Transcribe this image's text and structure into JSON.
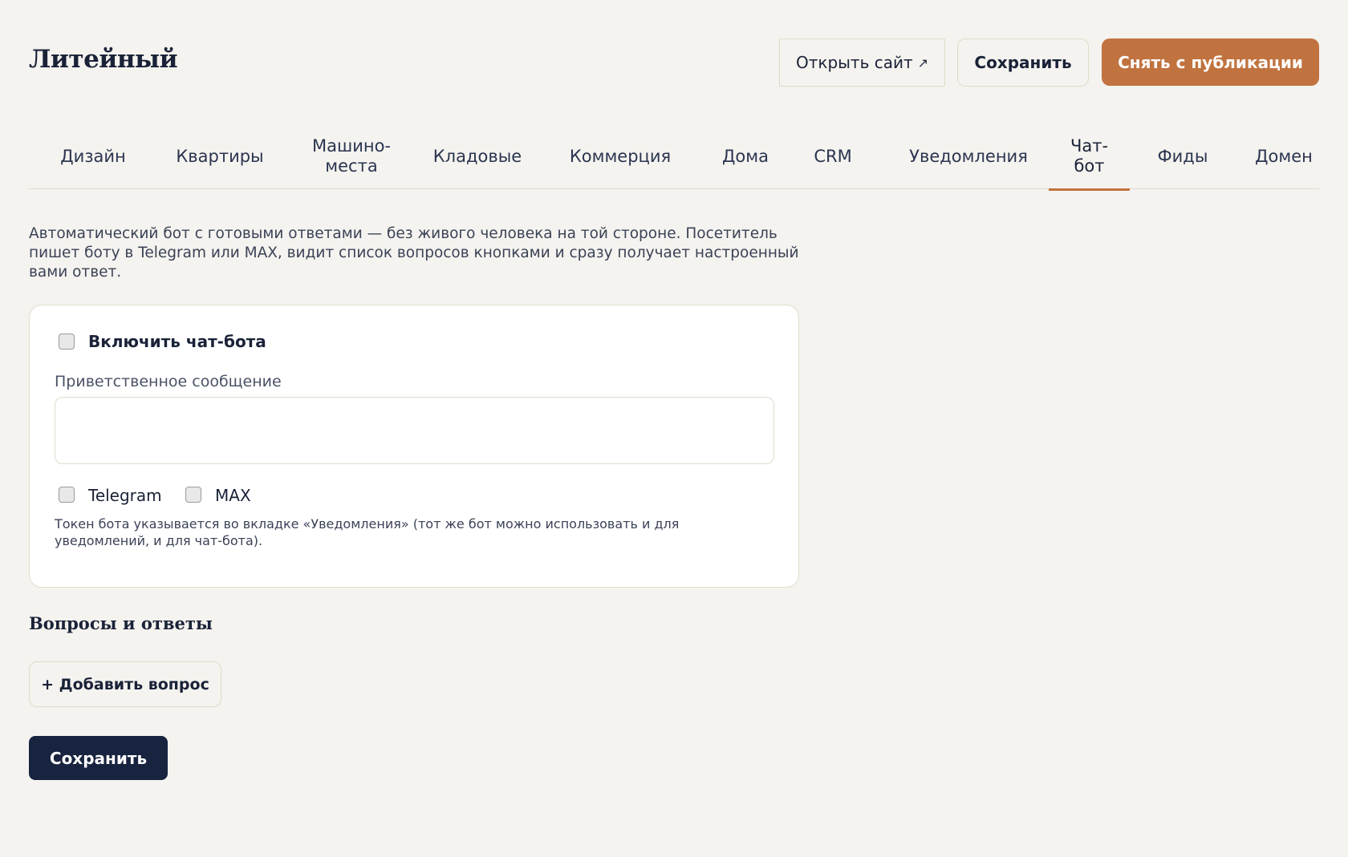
{
  "header": {
    "title": "Литейный",
    "open_site_label": "Открыть сайт",
    "open_site_icon": "external-link-icon",
    "save_label": "Сохранить",
    "unpublish_label": "Снять с публикации"
  },
  "tabs": [
    {
      "label": "Дизайн",
      "active": false
    },
    {
      "label": "Квартиры",
      "active": false
    },
    {
      "label": "Машино-\nместа",
      "active": false
    },
    {
      "label": "Кладовые",
      "active": false
    },
    {
      "label": "Коммерция",
      "active": false
    },
    {
      "label": "Дома",
      "active": false
    },
    {
      "label": "CRM",
      "active": false
    },
    {
      "label": "Уведомления",
      "active": false
    },
    {
      "label": "Чат-\nбот",
      "active": true
    },
    {
      "label": "Фиды",
      "active": false
    },
    {
      "label": "Домен",
      "active": false
    }
  ],
  "chatbot": {
    "description": "Автоматический бот с готовыми ответами — без живого человека на той стороне. Посетитель пишет боту в Telegram или MAX, видит список вопросов кнопками и сразу получает настроенный вами ответ.",
    "enable_label": "Включить чат-бота",
    "enabled": false,
    "welcome_label": "Приветственное сообщение",
    "welcome_value": "",
    "channels": [
      {
        "label": "Telegram",
        "checked": false
      },
      {
        "label": "MAX",
        "checked": false
      }
    ],
    "hint": "Токен бота указывается во вкладке «Уведомления» (тот же бот можно использовать и для уведомлений, и для чат-бота)."
  },
  "qa": {
    "title": "Вопросы и ответы",
    "add_label": "+ Добавить вопрос"
  },
  "footer": {
    "save_label": "Сохранить"
  },
  "colors": {
    "accent": "#c0733f",
    "primary_dark": "#182340",
    "background": "#f5f3ef"
  }
}
